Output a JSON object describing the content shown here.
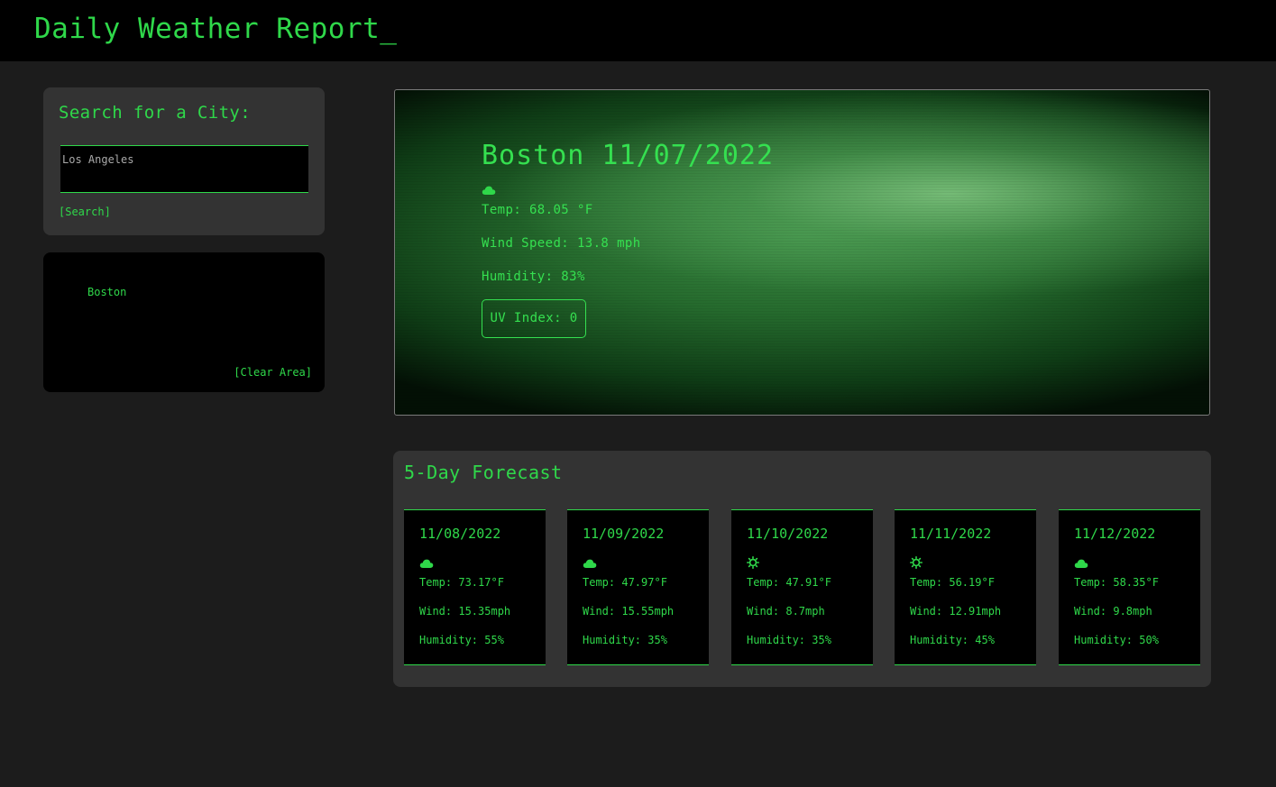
{
  "header": {
    "title": "Daily Weather Report_"
  },
  "search": {
    "heading": "Search for a City:",
    "input_value": "",
    "placeholder": "Los Angeles",
    "button_label": "[Search]"
  },
  "history": {
    "items": [
      {
        "label": "Boston"
      }
    ],
    "clear_label": "[Clear Area]"
  },
  "current": {
    "title": "Boston 11/07/2022",
    "icon": "cloud-icon",
    "temp": "Temp: 68.05 °F",
    "wind": "Wind Speed: 13.8 mph",
    "humidity": "Humidity: 83%",
    "uv": "UV Index: 0"
  },
  "forecast": {
    "heading": "5-Day Forecast",
    "days": [
      {
        "date": "11/08/2022",
        "icon": "cloud-icon",
        "temp": "Temp: 73.17°F",
        "wind": "Wind: 15.35mph",
        "humidity": "Humidity: 55%"
      },
      {
        "date": "11/09/2022",
        "icon": "cloud-icon",
        "temp": "Temp: 47.97°F",
        "wind": "Wind: 15.55mph",
        "humidity": "Humidity: 35%"
      },
      {
        "date": "11/10/2022",
        "icon": "sun-icon",
        "temp": "Temp: 47.91°F",
        "wind": "Wind: 8.7mph",
        "humidity": "Humidity: 35%"
      },
      {
        "date": "11/11/2022",
        "icon": "sun-icon",
        "temp": "Temp: 56.19°F",
        "wind": "Wind: 12.91mph",
        "humidity": "Humidity: 45%"
      },
      {
        "date": "11/12/2022",
        "icon": "cloud-icon",
        "temp": "Temp: 58.35°F",
        "wind": "Wind: 9.8mph",
        "humidity": "Humidity: 50%"
      }
    ]
  },
  "colors": {
    "accent": "#2fd84a",
    "background": "#1c1c1c",
    "panel": "#333333",
    "black": "#000000"
  }
}
